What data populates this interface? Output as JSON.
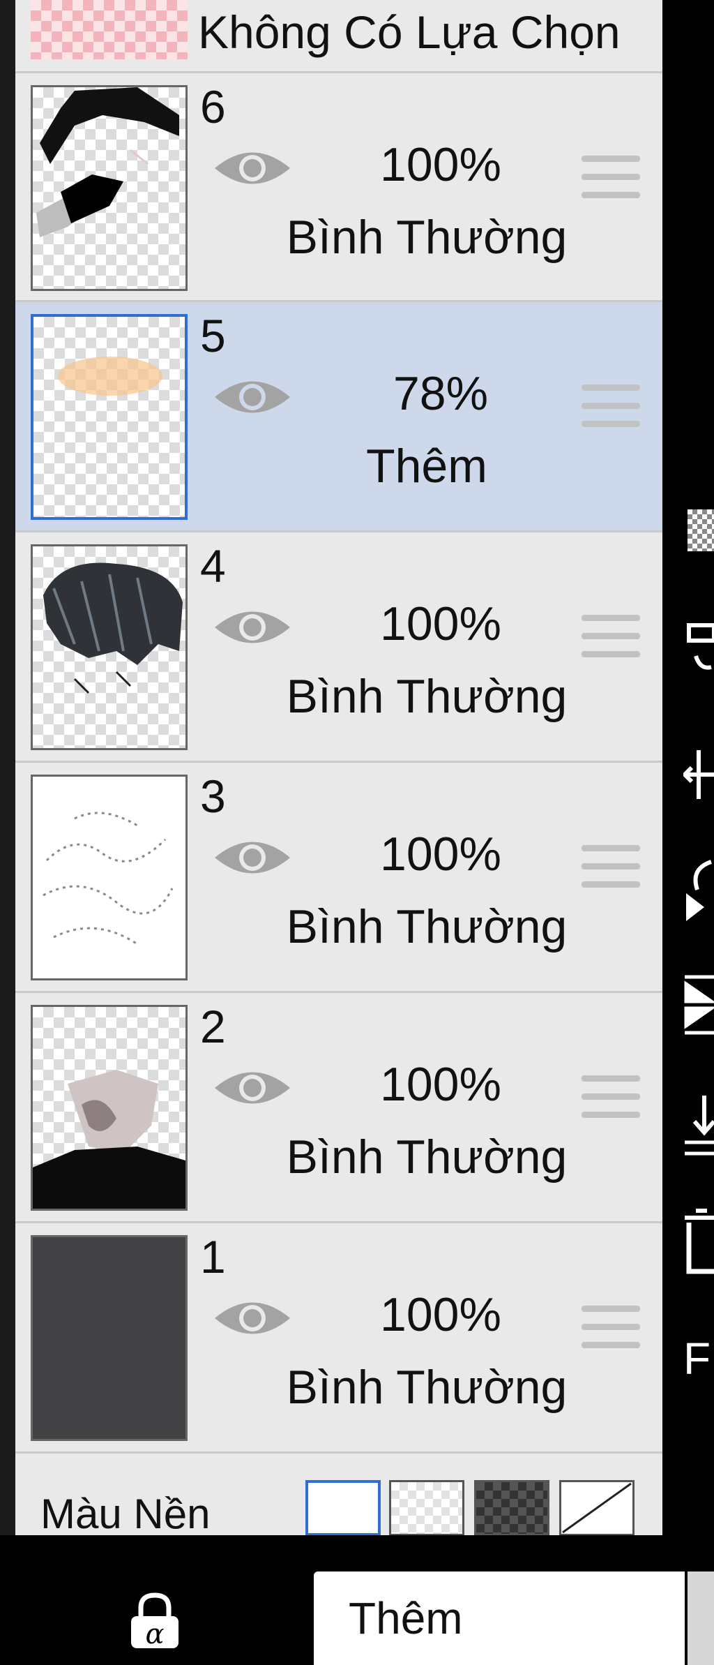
{
  "selection_row": {
    "label": "Không Có Lựa Chọn"
  },
  "layers": [
    {
      "number": "6",
      "opacity": "100%",
      "blend_mode": "Bình Thường",
      "selected": false
    },
    {
      "number": "5",
      "opacity": "78%",
      "blend_mode": "Thêm",
      "selected": true
    },
    {
      "number": "4",
      "opacity": "100%",
      "blend_mode": "Bình Thường",
      "selected": false
    },
    {
      "number": "3",
      "opacity": "100%",
      "blend_mode": "Bình Thường",
      "selected": false
    },
    {
      "number": "2",
      "opacity": "100%",
      "blend_mode": "Bình Thường",
      "selected": false
    },
    {
      "number": "1",
      "opacity": "100%",
      "blend_mode": "Bình Thường",
      "selected": false
    }
  ],
  "background": {
    "label": "Màu Nền",
    "options": [
      "white",
      "light-checker",
      "dark-checker",
      "none"
    ]
  },
  "toolbar": {
    "blend_mode_value": "Thêm",
    "lock_icon": "alpha-lock-icon",
    "right_icons": [
      "checker-icon",
      "merge-icon",
      "move-icon",
      "rotate-icon",
      "flip-icon",
      "merge-down-icon",
      "trash-icon",
      "more-icon"
    ],
    "right_partial_label": "F"
  },
  "colors": {
    "selected_bg": "#cdd9eb",
    "selected_border": "#2e6fd1",
    "panel_bg": "#e9e9e9"
  }
}
